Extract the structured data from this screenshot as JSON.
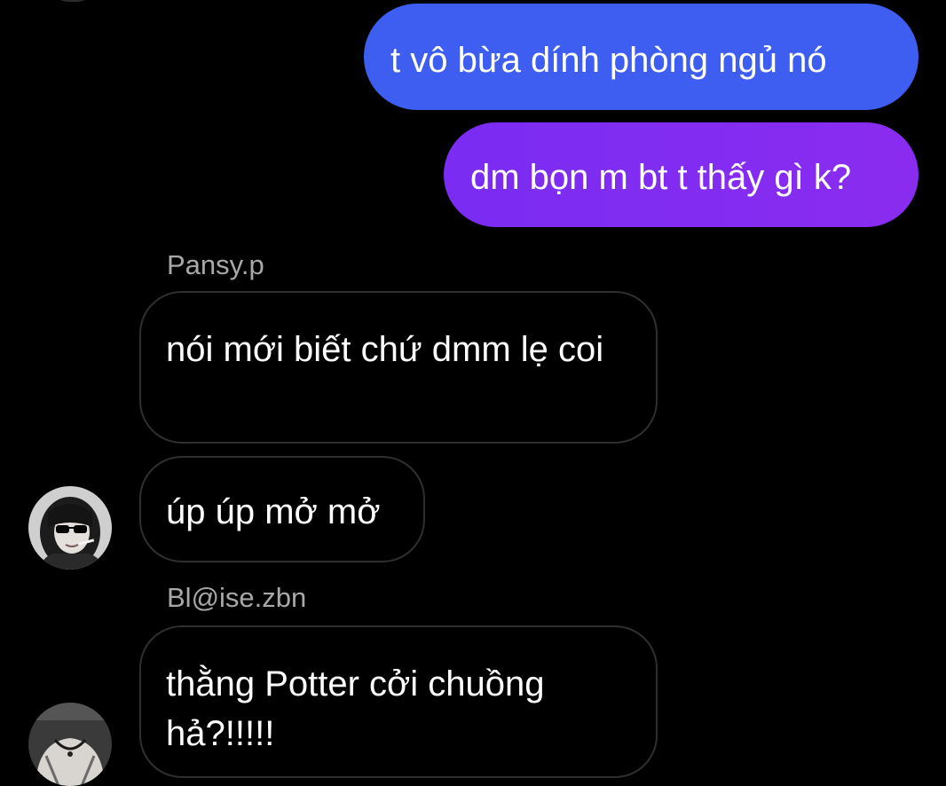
{
  "chat": {
    "outgoing": [
      {
        "text": "t vô bừa dính phòng ngủ nó",
        "color": "#3d5ef0"
      },
      {
        "text": "dm bọn m bt t thấy gì k?",
        "color": "#7a2cf2"
      }
    ],
    "groups": [
      {
        "sender": "Pansy.p",
        "avatar_icon": "person-with-sunglasses-avatar",
        "messages": [
          {
            "text": "nói mới biết chứ dmm lẹ coi"
          },
          {
            "text": "úp úp mở mở"
          }
        ]
      },
      {
        "sender": "Bl@ise.zbn",
        "avatar_icon": "person-with-necklace-avatar",
        "messages": [
          {
            "text": "thằng Potter cởi chuồng hả?!!!!!"
          }
        ]
      }
    ]
  },
  "colors": {
    "background": "#000000",
    "incoming_border": "#2f2f2f",
    "sender_name": "#a8a8a8"
  }
}
